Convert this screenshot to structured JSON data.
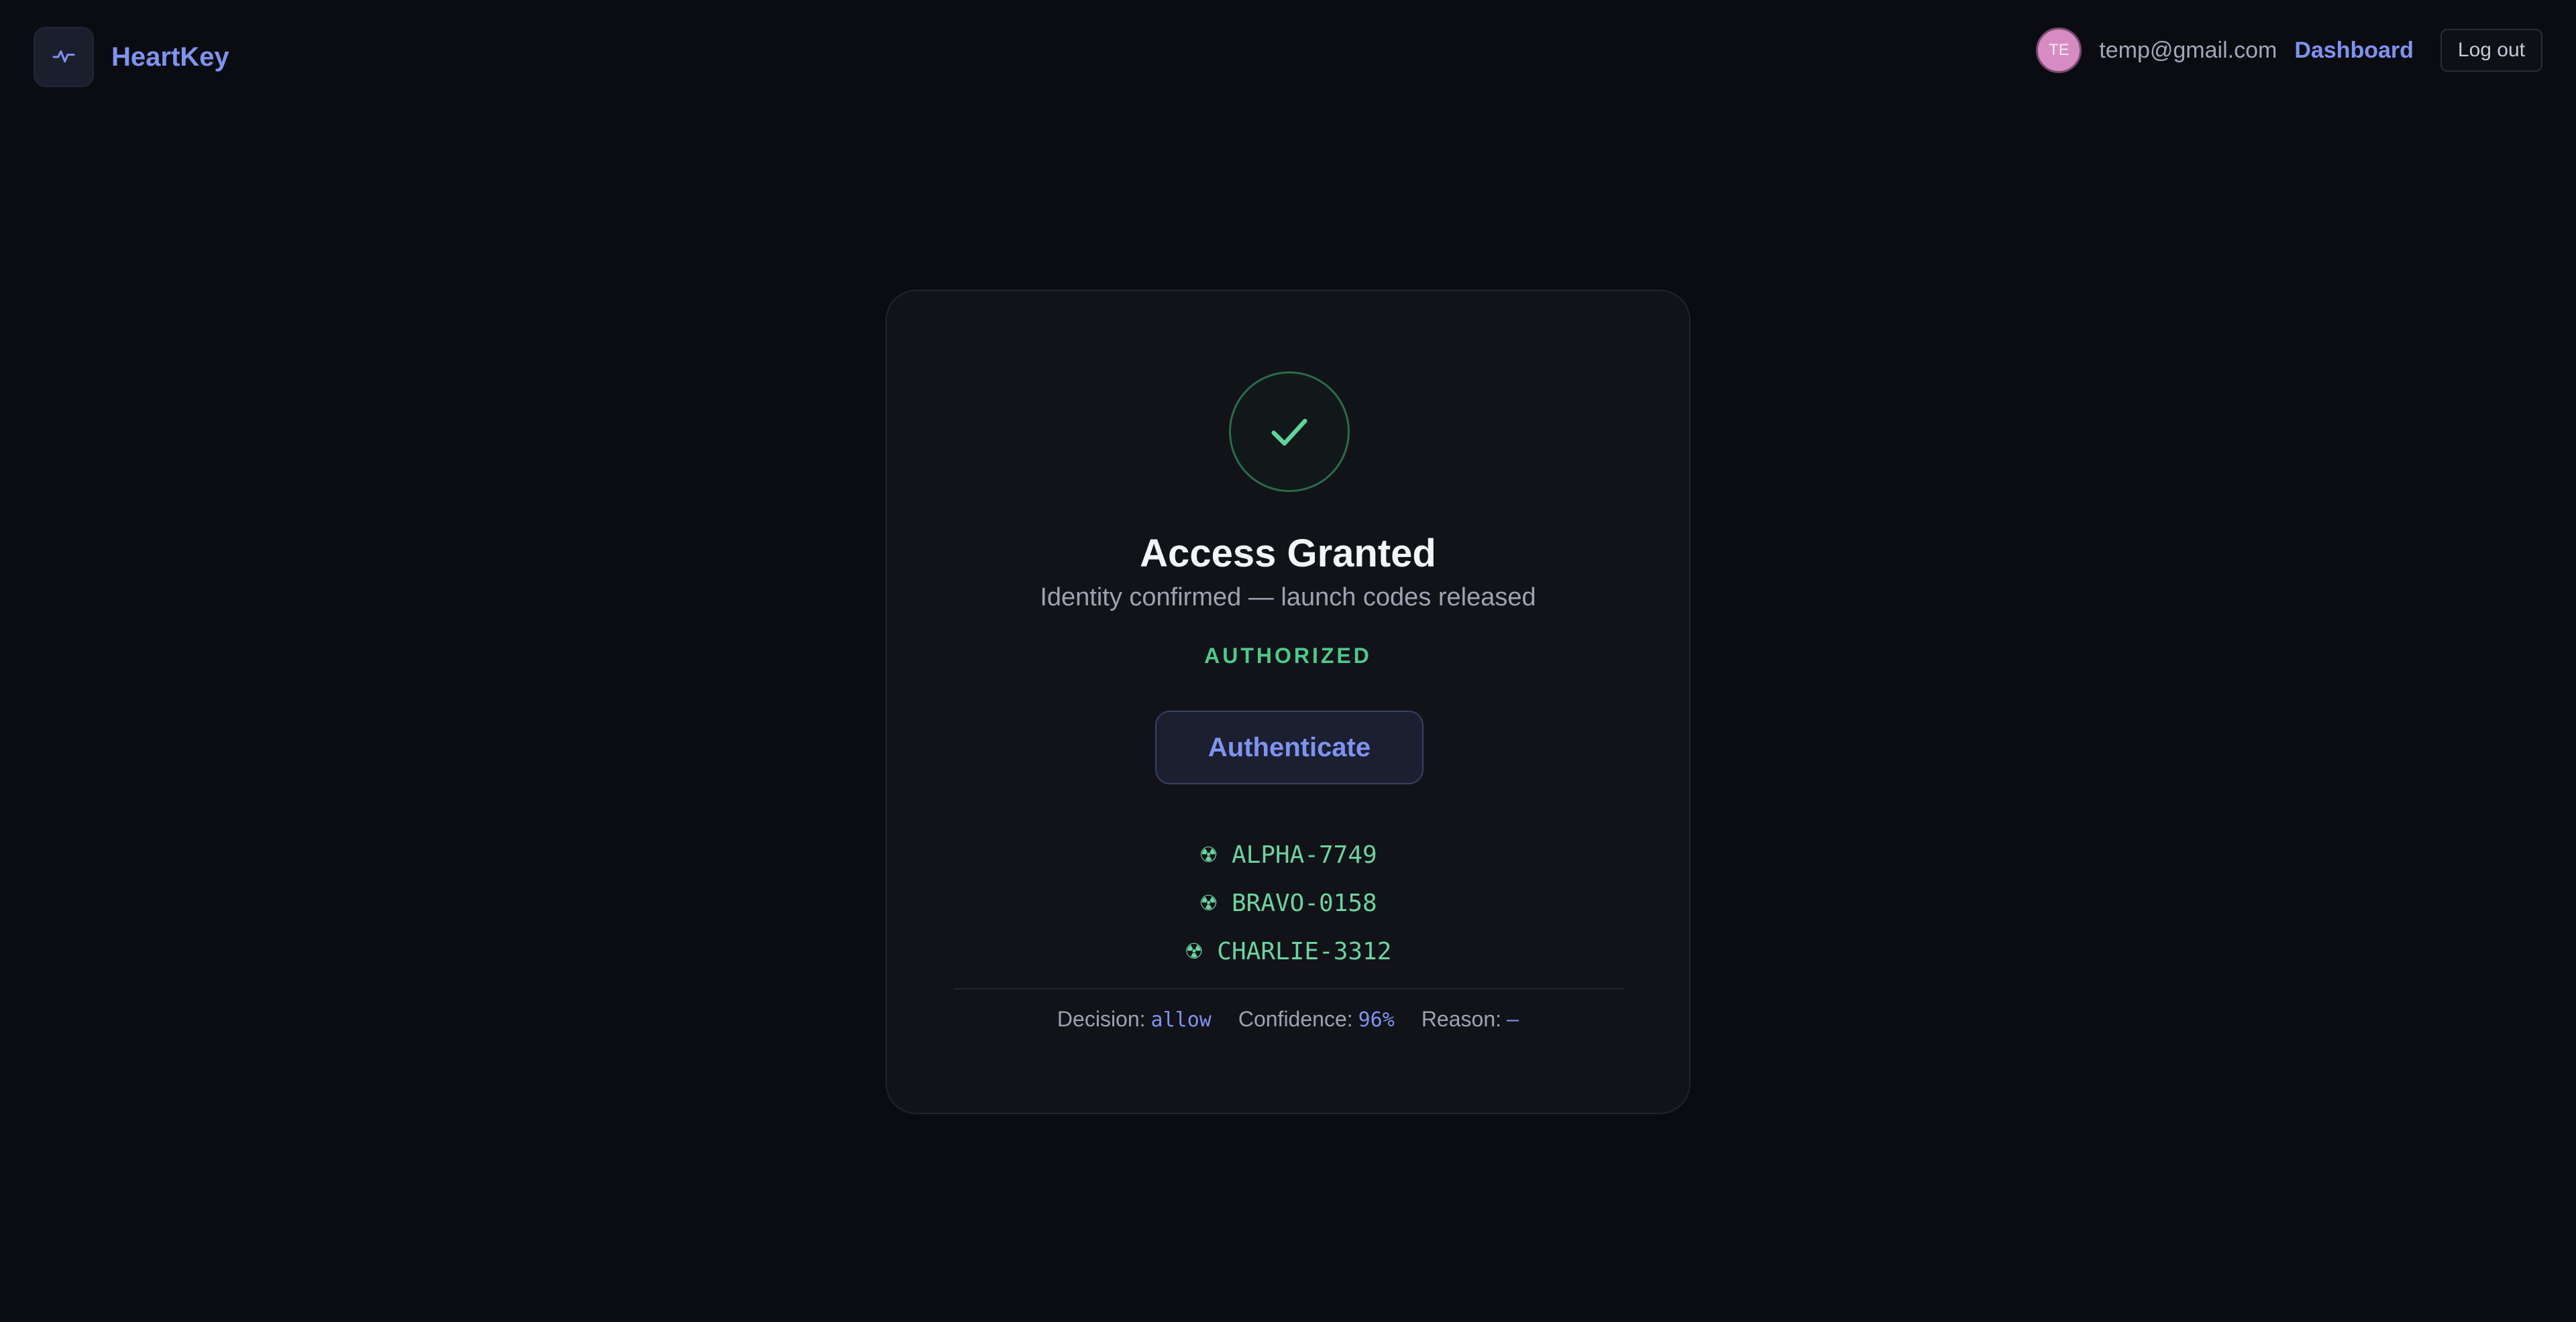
{
  "header": {
    "brand_name": "HeartKey",
    "brand_icon": "pulse-icon",
    "avatar_initials": "TE",
    "user_email": "temp@gmail.com",
    "dashboard_label": "Dashboard",
    "logout_label": "Log out"
  },
  "card": {
    "status_icon": "checkmark-icon",
    "title": "Access Granted",
    "subtitle": "Identity confirmed — launch codes released",
    "status_label": "AUTHORIZED",
    "authenticate_label": "Authenticate",
    "code_icon_glyph": "☢",
    "codes": [
      "ALPHA-7749",
      "BRAVO-0158",
      "CHARLIE-3312"
    ],
    "meta": {
      "decision_label": "Decision:",
      "decision_value": "allow",
      "confidence_label": "Confidence:",
      "confidence_value": "96%",
      "reason_label": "Reason:",
      "reason_value": "—"
    }
  },
  "colors": {
    "background": "#0b0c11",
    "card": "#121318",
    "accent": "#7f93f0",
    "success": "#4ec98b",
    "avatar": "#d68cc2"
  }
}
